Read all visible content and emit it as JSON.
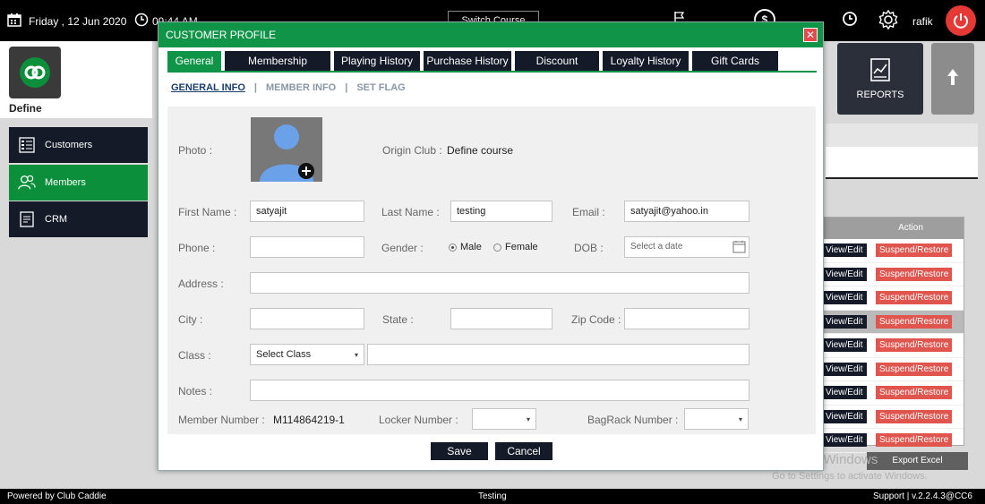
{
  "topbar": {
    "date_label": "Friday ,  12 Jun 2020",
    "time_label": "09:44 AM",
    "switch_label": "Switch Course",
    "user": "rafik"
  },
  "define": {
    "label": "Define"
  },
  "sidebar": {
    "items": [
      {
        "label": "Customers",
        "icon": "list-icon"
      },
      {
        "label": "Members",
        "icon": "users-icon"
      },
      {
        "label": "CRM",
        "icon": "document-icon"
      }
    ]
  },
  "background": {
    "reports_label": "REPORTS",
    "action_header": "Action",
    "view_edit": "View/Edit",
    "suspend_restore": "Suspend/Restore",
    "export_label": "Export Excel",
    "watermark_title": "Activate Windows",
    "watermark_sub": "Go to Settings to activate Windows."
  },
  "footer": {
    "powered": "Powered by Club Caddie",
    "center": "Testing",
    "right": "Support  |  v.2.2.4.3@CC6"
  },
  "dialog": {
    "title": "CUSTOMER PROFILE",
    "tabs": [
      "General",
      "Membership",
      "Playing History",
      "Purchase History",
      "Discount",
      "Loyalty History",
      "Gift Cards"
    ],
    "subtabs": [
      "GENERAL INFO",
      "|",
      "MEMBER INFO",
      "|",
      "SET FLAG"
    ],
    "save_label": "Save",
    "cancel_label": "Cancel"
  },
  "form": {
    "photo_label": "Photo :",
    "origin_label": "Origin Club :",
    "origin_value": "Define course",
    "first_name_label": "First Name :",
    "first_name_value": "satyajit",
    "last_name_label": "Last Name :",
    "last_name_value": "testing",
    "email_label": "Email :",
    "email_value": "satyajit@yahoo.in",
    "phone_label": "Phone :",
    "gender_label": "Gender :",
    "gender_male": "Male",
    "gender_female": "Female",
    "dob_label": "DOB :",
    "dob_placeholder": "Select a date",
    "address_label": "Address :",
    "city_label": "City :",
    "state_label": "State :",
    "zip_label": "Zip Code :",
    "class_label": "Class :",
    "class_value": "Select Class",
    "notes_label": "Notes :",
    "member_number_label": "Member Number :",
    "member_number_value": "M114864219-1",
    "locker_label": "Locker Number :",
    "bagrack_label": "BagRack Number :"
  }
}
